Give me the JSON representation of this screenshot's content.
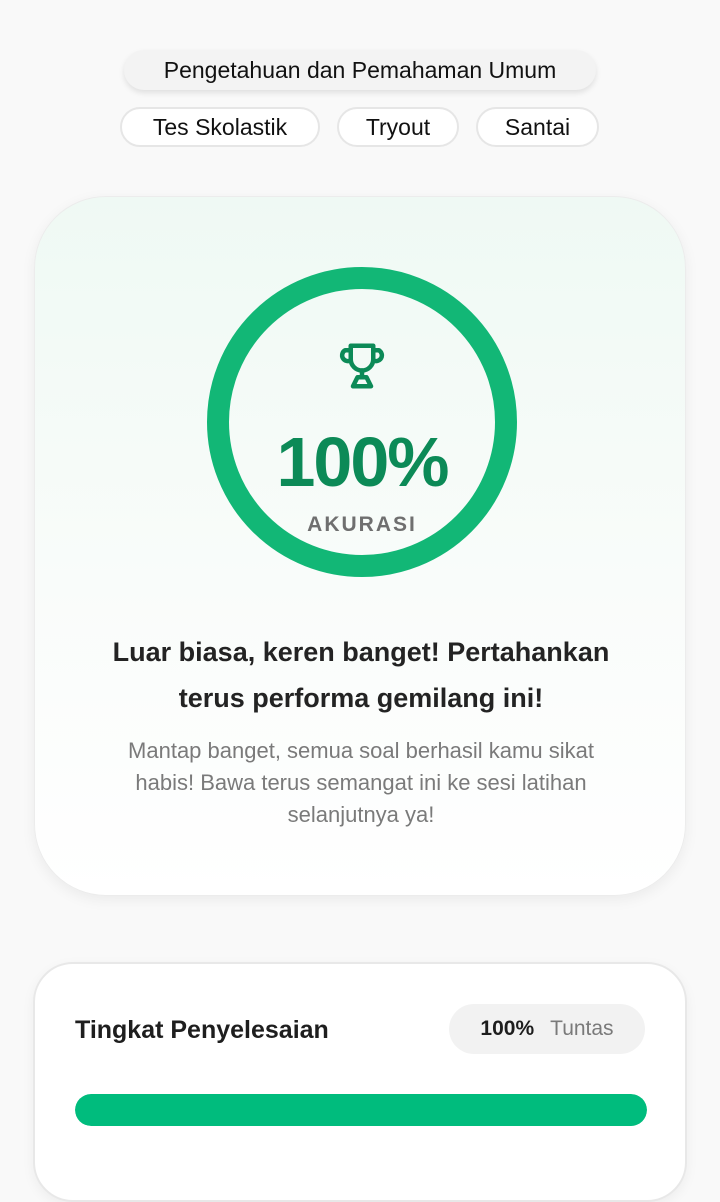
{
  "categories": {
    "main": "Pengetahuan dan Pemahaman Umum",
    "tags": [
      "Tes Skolastik",
      "Tryout",
      "Santai"
    ]
  },
  "result": {
    "icon": "trophy-icon",
    "accuracy_value": "100%",
    "accuracy_label": "AKURASI",
    "headline": "Luar biasa, keren banget! Pertahankan terus performa gemilang ini!",
    "description": "Mantap banget, semua soal berhasil kamu sikat habis! Bawa terus semangat ini ke sesi latihan selanjutnya ya!"
  },
  "completion": {
    "title": "Tingkat Penyelesaian",
    "value": "100%",
    "status": "Tuntas",
    "progress_fraction": 1.0
  },
  "colors": {
    "accent": "#12b776",
    "accent_dark": "#0c8a57",
    "progress": "#00bc7d"
  }
}
